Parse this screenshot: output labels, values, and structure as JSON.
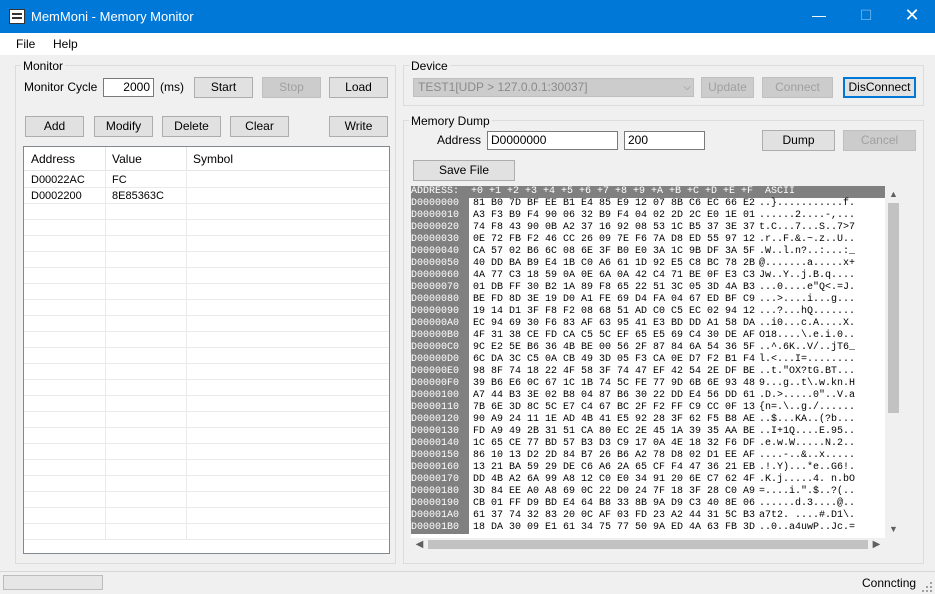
{
  "window": {
    "title": "MemMoni - Memory Monitor",
    "min_glyph": "—",
    "max_glyph": "☐",
    "close_glyph": "✕",
    "accent": "#0078d7"
  },
  "menu": {
    "file": "File",
    "help": "Help"
  },
  "monitor": {
    "group_label": "Monitor",
    "cycle_label": "Monitor Cycle",
    "cycle_value": "2000",
    "cycle_unit": "(ms)",
    "start": "Start",
    "stop": "Stop",
    "load": "Load",
    "add": "Add",
    "modify": "Modify",
    "delete": "Delete",
    "clear": "Clear",
    "write": "Write",
    "columns": [
      "Address",
      "Value",
      "Symbol"
    ],
    "rows": [
      {
        "address": "D00022AC",
        "value": "FC",
        "symbol": ""
      },
      {
        "address": "D0002200",
        "value": "8E85363C",
        "symbol": ""
      }
    ]
  },
  "device": {
    "group_label": "Device",
    "selected": "TEST1[UDP > 127.0.0.1:30037]",
    "update": "Update",
    "connect": "Connect",
    "disconnect": "DisConnect"
  },
  "dump": {
    "group_label": "Memory Dump",
    "address_label": "Address",
    "address_value": "D0000000",
    "size_value": "200",
    "dump_button": "Dump",
    "cancel_button": "Cancel",
    "save_button": "Save File",
    "header": "ADDRESS:  +0 +1 +2 +3 +4 +5 +6 +7 +8 +9 +A +B +C +D +E +F  ASCII",
    "rows": [
      {
        "addr": "D0000000",
        "hex": "81 B0 7D BF EE B1 E4 85 E9 12 07 8B C6 EC 66 E2",
        "ascii": "..}...........f."
      },
      {
        "addr": "D0000010",
        "hex": "A3 F3 B9 F4 90 06 32 B9 F4 04 02 2D 2C E0 1E 01",
        "ascii": "......2....-,..."
      },
      {
        "addr": "D0000020",
        "hex": "74 F8 43 90 0B A2 37 16 92 08 53 1C B5 37 3E 37",
        "ascii": "t.C...7...S..7>7"
      },
      {
        "addr": "D0000030",
        "hex": "0E 72 FB F2 46 CC 26 09 7E F6 7A D8 ED 55 97 12",
        "ascii": ".r..F.&.~.z..U.."
      },
      {
        "addr": "D0000040",
        "hex": "CA 57 02 B6 6C 08 6E 3F B0 E0 3A 1C 9B DF 3A 5F",
        "ascii": ".W..l.n?..:...:_"
      },
      {
        "addr": "D0000050",
        "hex": "40 DD BA B9 E4 1B C0 A6 61 1D 92 E5 C8 BC 78 2B",
        "ascii": "@.......a.....x+"
      },
      {
        "addr": "D0000060",
        "hex": "4A 77 C3 18 59 0A 0E 6A 0A 42 C4 71 BE 0F E3 C3",
        "ascii": "Jw..Y..j.B.q...."
      },
      {
        "addr": "D0000070",
        "hex": "01 DB FF 30 B2 1A 89 F8 65 22 51 3C 05 3D 4A B3",
        "ascii": "...0....e\"Q<.=J."
      },
      {
        "addr": "D0000080",
        "hex": "BE FD 8D 3E 19 D0 A1 FE 69 D4 FA 04 67 ED BF C9",
        "ascii": "...>....i...g..."
      },
      {
        "addr": "D0000090",
        "hex": "19 14 D1 3F F8 F2 08 68 51 AD C0 C5 EC 02 94 12",
        "ascii": "...?...hQ......."
      },
      {
        "addr": "D00000A0",
        "hex": "EC 94 69 30 F6 83 AF 63 95 41 E3 BD DD A1 58 DA",
        "ascii": "..i0...c.A....X."
      },
      {
        "addr": "D00000B0",
        "hex": "4F 31 38 CE FD CA C5 5C EF 65 E5 69 C4 30 DE AF",
        "ascii": "O18....\\.e.i.0.."
      },
      {
        "addr": "D00000C0",
        "hex": "9C E2 5E B6 36 4B BE 00 56 2F 87 84 6A 54 36 5F",
        "ascii": "..^.6K..V/..jT6_"
      },
      {
        "addr": "D00000D0",
        "hex": "6C DA 3C C5 0A CB 49 3D 05 F3 CA 0E D7 F2 B1 F4",
        "ascii": "l.<...I=........"
      },
      {
        "addr": "D00000E0",
        "hex": "98 8F 74 18 22 4F 58 3F 74 47 EF 42 54 2E DF BE",
        "ascii": "..t.\"OX?tG.BT..."
      },
      {
        "addr": "D00000F0",
        "hex": "39 B6 E6 0C 67 1C 1B 74 5C FE 77 9D 6B 6E 93 48",
        "ascii": "9...g..t\\.w.kn.H"
      },
      {
        "addr": "D0000100",
        "hex": "A7 44 B3 3E 02 B8 04 87 B6 30 22 DD E4 56 DD 61",
        "ascii": ".D.>.....0\"..V.a"
      },
      {
        "addr": "D0000110",
        "hex": "7B 6E 3D 8C 5C E7 C4 67 BC 2F F2 FF C9 CC 0F 13",
        "ascii": "{n=.\\..g./......"
      },
      {
        "addr": "D0000120",
        "hex": "90 A9 24 11 1E AD 4B 41 E5 92 28 3F 62 F5 B8 AE",
        "ascii": "..$...KA..(?b..."
      },
      {
        "addr": "D0000130",
        "hex": "FD A9 49 2B 31 51 CA 80 EC 2E 45 1A 39 35 AA BE",
        "ascii": "..I+1Q....E.95.."
      },
      {
        "addr": "D0000140",
        "hex": "1C 65 CE 77 BD 57 B3 D3 C9 17 0A 4E 18 32 F6 DF",
        "ascii": ".e.w.W.....N.2.."
      },
      {
        "addr": "D0000150",
        "hex": "86 10 13 D2 2D 84 B7 26 B6 A2 78 D8 02 D1 EE AF",
        "ascii": "....-..&..x....."
      },
      {
        "addr": "D0000160",
        "hex": "13 21 BA 59 29 DE C6 A6 2A 65 CF F4 47 36 21 EB",
        "ascii": ".!.Y)...*e..G6!."
      },
      {
        "addr": "D0000170",
        "hex": "DD 4B A2 6A 99 A8 12 C0 E0 34 91 20 6E C7 62 4F",
        "ascii": ".K.j.....4. n.bO"
      },
      {
        "addr": "D0000180",
        "hex": "3D 84 EE A0 A8 69 0C 22 D0 24 7F 18 3F 28 C0 A9",
        "ascii": "=....i.\".$..?(.."
      },
      {
        "addr": "D0000190",
        "hex": "CB 01 FF D9 BD E4 64 B8 33 8B 9A D9 C3 40 8E 06",
        "ascii": "......d.3....@.."
      },
      {
        "addr": "D00001A0",
        "hex": "61 37 74 32 83 20 0C AF 03 FD 23 A2 44 31 5C B3",
        "ascii": "a7t2. ....#.D1\\."
      },
      {
        "addr": "D00001B0",
        "hex": "18 DA 30 09 E1 61 34 75 77 50 9A ED 4A 63 FB 3D",
        "ascii": "..0..a4uwP..Jc.="
      }
    ]
  },
  "status": {
    "text": "Conncting"
  },
  "scroll": {
    "up": "▲",
    "down": "▼",
    "left": "◀",
    "right": "▶"
  }
}
